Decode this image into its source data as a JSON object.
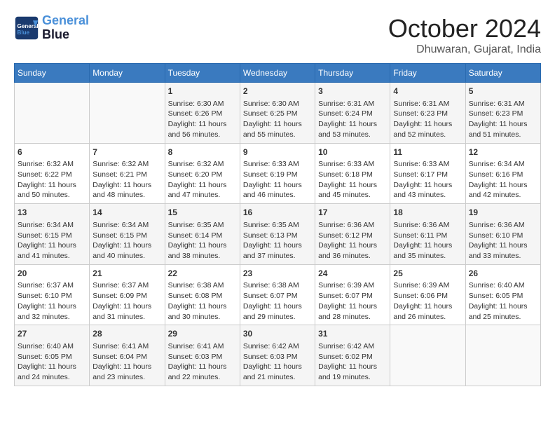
{
  "header": {
    "logo_general": "General",
    "logo_blue": "Blue",
    "month": "October 2024",
    "location": "Dhuwaran, Gujarat, India"
  },
  "days_of_week": [
    "Sunday",
    "Monday",
    "Tuesday",
    "Wednesday",
    "Thursday",
    "Friday",
    "Saturday"
  ],
  "weeks": [
    [
      {
        "day": "",
        "info": ""
      },
      {
        "day": "",
        "info": ""
      },
      {
        "day": "1",
        "info": "Sunrise: 6:30 AM\nSunset: 6:26 PM\nDaylight: 11 hours and 56 minutes."
      },
      {
        "day": "2",
        "info": "Sunrise: 6:30 AM\nSunset: 6:25 PM\nDaylight: 11 hours and 55 minutes."
      },
      {
        "day": "3",
        "info": "Sunrise: 6:31 AM\nSunset: 6:24 PM\nDaylight: 11 hours and 53 minutes."
      },
      {
        "day": "4",
        "info": "Sunrise: 6:31 AM\nSunset: 6:23 PM\nDaylight: 11 hours and 52 minutes."
      },
      {
        "day": "5",
        "info": "Sunrise: 6:31 AM\nSunset: 6:23 PM\nDaylight: 11 hours and 51 minutes."
      }
    ],
    [
      {
        "day": "6",
        "info": "Sunrise: 6:32 AM\nSunset: 6:22 PM\nDaylight: 11 hours and 50 minutes."
      },
      {
        "day": "7",
        "info": "Sunrise: 6:32 AM\nSunset: 6:21 PM\nDaylight: 11 hours and 48 minutes."
      },
      {
        "day": "8",
        "info": "Sunrise: 6:32 AM\nSunset: 6:20 PM\nDaylight: 11 hours and 47 minutes."
      },
      {
        "day": "9",
        "info": "Sunrise: 6:33 AM\nSunset: 6:19 PM\nDaylight: 11 hours and 46 minutes."
      },
      {
        "day": "10",
        "info": "Sunrise: 6:33 AM\nSunset: 6:18 PM\nDaylight: 11 hours and 45 minutes."
      },
      {
        "day": "11",
        "info": "Sunrise: 6:33 AM\nSunset: 6:17 PM\nDaylight: 11 hours and 43 minutes."
      },
      {
        "day": "12",
        "info": "Sunrise: 6:34 AM\nSunset: 6:16 PM\nDaylight: 11 hours and 42 minutes."
      }
    ],
    [
      {
        "day": "13",
        "info": "Sunrise: 6:34 AM\nSunset: 6:15 PM\nDaylight: 11 hours and 41 minutes."
      },
      {
        "day": "14",
        "info": "Sunrise: 6:34 AM\nSunset: 6:15 PM\nDaylight: 11 hours and 40 minutes."
      },
      {
        "day": "15",
        "info": "Sunrise: 6:35 AM\nSunset: 6:14 PM\nDaylight: 11 hours and 38 minutes."
      },
      {
        "day": "16",
        "info": "Sunrise: 6:35 AM\nSunset: 6:13 PM\nDaylight: 11 hours and 37 minutes."
      },
      {
        "day": "17",
        "info": "Sunrise: 6:36 AM\nSunset: 6:12 PM\nDaylight: 11 hours and 36 minutes."
      },
      {
        "day": "18",
        "info": "Sunrise: 6:36 AM\nSunset: 6:11 PM\nDaylight: 11 hours and 35 minutes."
      },
      {
        "day": "19",
        "info": "Sunrise: 6:36 AM\nSunset: 6:10 PM\nDaylight: 11 hours and 33 minutes."
      }
    ],
    [
      {
        "day": "20",
        "info": "Sunrise: 6:37 AM\nSunset: 6:10 PM\nDaylight: 11 hours and 32 minutes."
      },
      {
        "day": "21",
        "info": "Sunrise: 6:37 AM\nSunset: 6:09 PM\nDaylight: 11 hours and 31 minutes."
      },
      {
        "day": "22",
        "info": "Sunrise: 6:38 AM\nSunset: 6:08 PM\nDaylight: 11 hours and 30 minutes."
      },
      {
        "day": "23",
        "info": "Sunrise: 6:38 AM\nSunset: 6:07 PM\nDaylight: 11 hours and 29 minutes."
      },
      {
        "day": "24",
        "info": "Sunrise: 6:39 AM\nSunset: 6:07 PM\nDaylight: 11 hours and 28 minutes."
      },
      {
        "day": "25",
        "info": "Sunrise: 6:39 AM\nSunset: 6:06 PM\nDaylight: 11 hours and 26 minutes."
      },
      {
        "day": "26",
        "info": "Sunrise: 6:40 AM\nSunset: 6:05 PM\nDaylight: 11 hours and 25 minutes."
      }
    ],
    [
      {
        "day": "27",
        "info": "Sunrise: 6:40 AM\nSunset: 6:05 PM\nDaylight: 11 hours and 24 minutes."
      },
      {
        "day": "28",
        "info": "Sunrise: 6:41 AM\nSunset: 6:04 PM\nDaylight: 11 hours and 23 minutes."
      },
      {
        "day": "29",
        "info": "Sunrise: 6:41 AM\nSunset: 6:03 PM\nDaylight: 11 hours and 22 minutes."
      },
      {
        "day": "30",
        "info": "Sunrise: 6:42 AM\nSunset: 6:03 PM\nDaylight: 11 hours and 21 minutes."
      },
      {
        "day": "31",
        "info": "Sunrise: 6:42 AM\nSunset: 6:02 PM\nDaylight: 11 hours and 19 minutes."
      },
      {
        "day": "",
        "info": ""
      },
      {
        "day": "",
        "info": ""
      }
    ]
  ]
}
